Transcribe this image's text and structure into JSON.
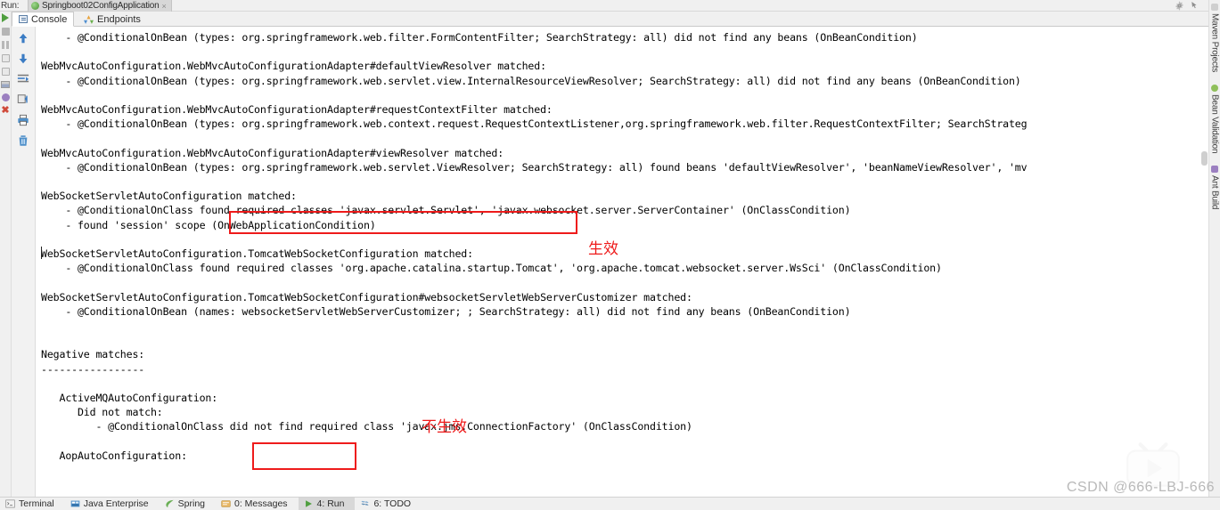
{
  "window": {
    "run_label": "Run:",
    "tab_title": "Springboot02ConfigApplication",
    "tab_close": "×",
    "gear_icon": "gear-icon",
    "hide_icon": "hide-window-icon"
  },
  "run_toolbar": {
    "items": [
      {
        "name": "rerun-button",
        "icon": "play-icon"
      },
      {
        "name": "stop-button",
        "icon": "stop-square-icon"
      },
      {
        "name": "pause-button",
        "icon": "pause-icon"
      },
      {
        "name": "dump-threads-button",
        "icon": "thread-dump-icon"
      },
      {
        "name": "restore-layout-button",
        "icon": "restore-layout-icon"
      },
      {
        "name": "settings-button",
        "icon": "layers-icon"
      },
      {
        "name": "debug-button",
        "icon": "bug-icon"
      },
      {
        "name": "close-button",
        "icon": "close-x-icon"
      }
    ]
  },
  "console_tabs": [
    {
      "label": "Console",
      "icon": "console-icon",
      "active": true
    },
    {
      "label": "Endpoints",
      "icon": "endpoints-icon",
      "active": false
    }
  ],
  "gutter_toolbar": {
    "items": [
      {
        "name": "up-arrow-button",
        "icon": "arrow-up-icon"
      },
      {
        "name": "down-arrow-button",
        "icon": "arrow-down-icon"
      },
      {
        "name": "soft-wrap-button",
        "icon": "soft-wrap-icon"
      },
      {
        "name": "scroll-to-end-button",
        "icon": "scroll-to-end-icon"
      },
      {
        "name": "print-button",
        "icon": "printer-icon"
      },
      {
        "name": "clear-all-button",
        "icon": "trash-icon"
      }
    ]
  },
  "console": {
    "text": "    - @ConditionalOnBean (types: org.springframework.web.filter.FormContentFilter; SearchStrategy: all) did not find any beans (OnBeanCondition)\n\nWebMvcAutoConfiguration.WebMvcAutoConfigurationAdapter#defaultViewResolver matched:\n    - @ConditionalOnBean (types: org.springframework.web.servlet.view.InternalResourceViewResolver; SearchStrategy: all) did not find any beans (OnBeanCondition)\n\nWebMvcAutoConfiguration.WebMvcAutoConfigurationAdapter#requestContextFilter matched:\n    - @ConditionalOnBean (types: org.springframework.web.context.request.RequestContextListener,org.springframework.web.filter.RequestContextFilter; SearchStrateg\n\nWebMvcAutoConfiguration.WebMvcAutoConfigurationAdapter#viewResolver matched:\n    - @ConditionalOnBean (types: org.springframework.web.servlet.ViewResolver; SearchStrategy: all) found beans 'defaultViewResolver', 'beanNameViewResolver', 'mv\n\nWebSocketServletAutoConfiguration matched:\n    - @ConditionalOnClass found required classes 'javax.servlet.Servlet', 'javax.websocket.server.ServerContainer' (OnClassCondition)\n    - found 'session' scope (OnWebApplicationCondition)\n\nWebSocketServletAutoConfiguration.TomcatWebSocketConfiguration matched:\n    - @ConditionalOnClass found required classes 'org.apache.catalina.startup.Tomcat', 'org.apache.tomcat.websocket.server.WsSci' (OnClassCondition)\n\nWebSocketServletAutoConfiguration.TomcatWebSocketConfiguration#websocketServletWebServerCustomizer matched:\n    - @ConditionalOnBean (names: websocketServletWebServerCustomizer; ; SearchStrategy: all) did not find any beans (OnBeanCondition)\n\n\nNegative matches:\n-----------------\n\n   ActiveMQAutoConfiguration:\n      Did not match:\n         - @ConditionalOnClass did not find required class 'javax.jms.ConnectionFactory' (OnClassCondition)\n\n   AopAutoConfiguration:"
  },
  "annotations": {
    "box1_label": "生效",
    "box2_label": "不生效",
    "highlight_color": "#ee1b1b",
    "box1_text": "found required classes 'javax.servlet.Servlet',",
    "box2_text": "did not find"
  },
  "right_bar": {
    "items": [
      {
        "label": "Maven Projects",
        "icon": "maven-icon",
        "color": "#c9c9c9"
      },
      {
        "label": "Bean Validation",
        "icon": "bean-validation-icon",
        "color": "#8fbf5a"
      },
      {
        "label": "Ant Build",
        "icon": "ant-build-icon",
        "color": "#9b7fc0"
      }
    ]
  },
  "status_bar": {
    "items": [
      {
        "label": "Terminal",
        "icon": "terminal-icon",
        "active": false,
        "shortcut": ""
      },
      {
        "label": "Java Enterprise",
        "icon": "java-enterprise-icon",
        "active": false,
        "shortcut": ""
      },
      {
        "label": "Spring",
        "icon": "spring-leaf-icon",
        "active": false,
        "shortcut": ""
      },
      {
        "label": "0: Messages",
        "icon": "messages-icon",
        "active": false,
        "shortcut": "0"
      },
      {
        "label": "4: Run",
        "icon": "run-play-icon",
        "active": true,
        "shortcut": "4"
      },
      {
        "label": "6: TODO",
        "icon": "todo-icon",
        "active": false,
        "shortcut": "6"
      }
    ]
  },
  "watermark": {
    "text": "CSDN @666-LBJ-666",
    "logo": "bilibili-play-logo"
  }
}
